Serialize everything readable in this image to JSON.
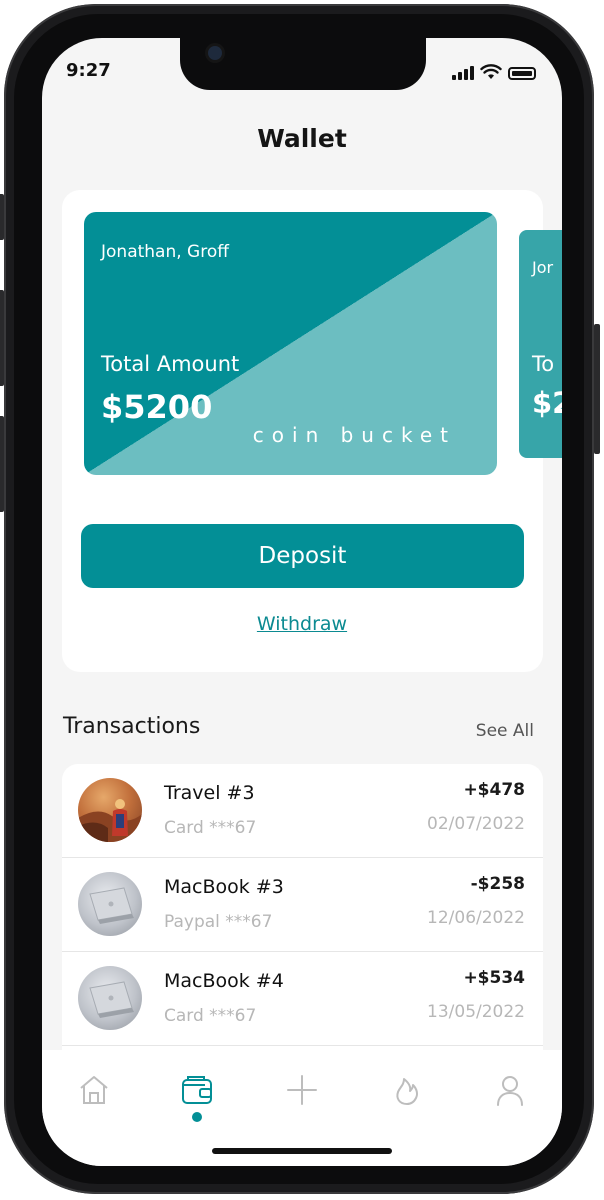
{
  "status_bar": {
    "time": "9:27"
  },
  "header": {
    "title": "Wallet"
  },
  "cards": [
    {
      "holder": "Jonathan, Groff",
      "amount_label": "Total Amount",
      "amount": "$5200",
      "brand": "coin bucket"
    },
    {
      "holder": "Jor",
      "amount_label": "To",
      "amount": "$2"
    }
  ],
  "actions": {
    "deposit_label": "Deposit",
    "withdraw_label": "Withdraw"
  },
  "transactions": {
    "title": "Transactions",
    "see_all_label": "See All",
    "items": [
      {
        "name": "Travel #3",
        "method": "Card ***67",
        "amount": "+$478",
        "date": "02/07/2022",
        "avatar": "travel-photo"
      },
      {
        "name": "MacBook #3",
        "method": "Paypal ***67",
        "amount": "-$258",
        "date": "12/06/2022",
        "avatar": "macbook-photo"
      },
      {
        "name": "MacBook #4",
        "method": "Card ***67",
        "amount": "+$534",
        "date": "13/05/2022",
        "avatar": "macbook-photo"
      }
    ]
  },
  "tab_bar": {
    "items": [
      {
        "icon": "home-icon"
      },
      {
        "icon": "wallet-icon",
        "active": true
      },
      {
        "icon": "plus-icon"
      },
      {
        "icon": "flame-icon"
      },
      {
        "icon": "profile-icon"
      }
    ]
  },
  "colors": {
    "accent": "#038f96",
    "card_light": "#6cbec1",
    "background": "#f5f5f5"
  }
}
